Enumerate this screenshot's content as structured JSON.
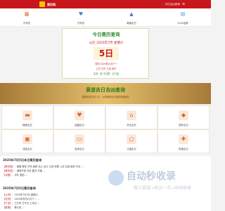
{
  "topbar": {
    "brand": "黄历网",
    "today_link": "今日吉凶查询"
  },
  "quicknav": [
    {
      "label": "万年历",
      "icon": "calendar-icon"
    },
    {
      "label": "万年历",
      "icon": "heart-icon"
    },
    {
      "label": "黄道吉日",
      "icon": "chart-icon"
    },
    {
      "label": "2025运势",
      "icon": "grid-icon"
    }
  ],
  "date_card": {
    "heading": "今日黄历查询",
    "solar": "公历 2025年7月 星期六",
    "day": "5日",
    "lunar": "农历 2025年六月十一",
    "ganzhi": "乙巳 壬午 乙未 丙子",
    "extra": "生肖：蛇  今日属：五行金"
  },
  "banner": {
    "title": "黄道吉日吉凶查询",
    "subtitle": "根据您的生辰八字，为您推荐吉日良辰详细查询"
  },
  "grid_items": [
    {
      "label": "搬家吉日",
      "icon": "truck-icon"
    },
    {
      "label": "结婚吉日",
      "icon": "heart-icon"
    },
    {
      "label": "开业吉日",
      "icon": "shop-icon"
    },
    {
      "label": "提车吉日",
      "icon": "car-icon"
    },
    {
      "label": "领证吉日",
      "icon": "certificate-icon"
    },
    {
      "label": "安床吉日",
      "icon": "bed-icon"
    },
    {
      "label": "订婚吉日",
      "icon": "ring-icon"
    },
    {
      "label": "修造吉日",
      "icon": "tools-icon"
    }
  ],
  "section1": {
    "title": "2025年7月5日本日黄历查询",
    "rows": [
      {
        "tag": "【黄历宜】",
        "text": "：嫁娶 祭祀 开市 纳财 动土 出行 立券 安葬 入宅 交易 裁衣 开仓 …"
      },
      {
        "tag": "【黄历忌】",
        "text": "：诸事不宜 作灶 掘井 开渠 …"
      },
      {
        "tag": "【冲煞】",
        "text": "：冲牛 煞西 …"
      }
    ]
  },
  "section2": {
    "title": "2025年7月5日黄历查询",
    "rows": [
      {
        "tag": "【公历】",
        "text": "：2025年7月5日 星期六"
      },
      {
        "tag": "【农历】",
        "text": "：2025年农历六月十一 …"
      },
      {
        "tag": "【干支】",
        "text": "：乙巳年 壬午月 乙未日 …"
      },
      {
        "tag": "【星宿】",
        "text": "：翼火蛇 …"
      }
    ]
  },
  "watermark": {
    "title": "自动秒收录",
    "subtitle": "做上链接→来访一次→自动收录"
  },
  "colors": {
    "brand_red": "#c8161d",
    "heading_green": "#2c8c2c",
    "banner_gold": "#e6bf6b"
  }
}
